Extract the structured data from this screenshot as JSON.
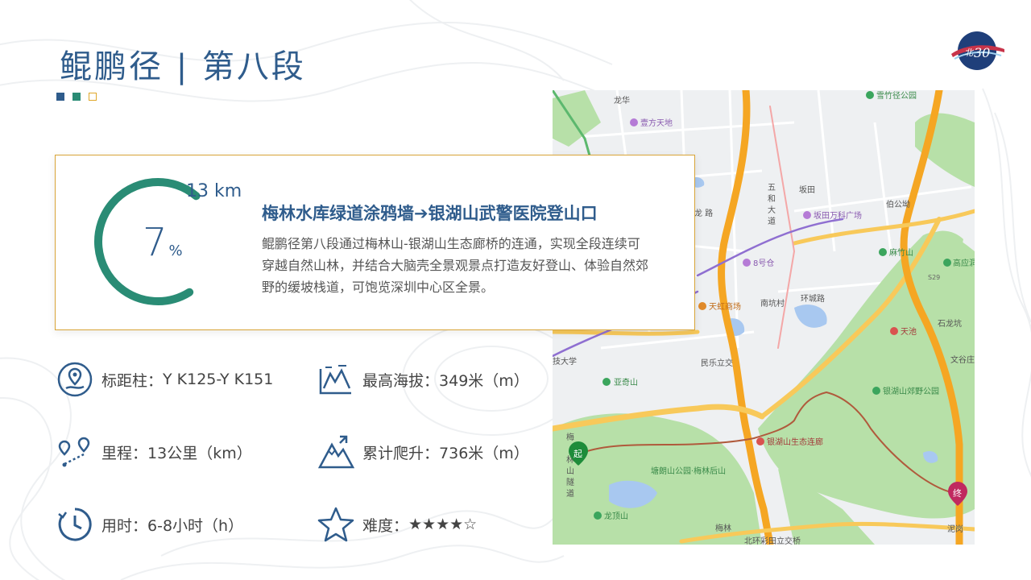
{
  "header": {
    "title": "鲲鹏径 | 第八段"
  },
  "summary": {
    "distance": "13 km",
    "percent": "7",
    "percent_unit": "%",
    "progress_fraction": 0.7,
    "route_title": "梅林水库绿道涂鸦墙➔银湖山武警医院登山口",
    "description": "鲲鹏径第八段通过梅林山-银湖山生态廊桥的连通，实现全段连续可穿越自然山林，并结合大脑壳全景观景点打造友好登山、体验自然郊野的缓坡栈道，可饱览深圳中心区全景。"
  },
  "stats": {
    "marker_label": "标距柱：",
    "marker_value": "Y K125-Y K151",
    "altitude_label": "最高海拔：",
    "altitude_value": "349米（m）",
    "distance_label": "里程：",
    "distance_value": "13公里（km）",
    "climb_label": "累计爬升：",
    "climb_value": "736米（m）",
    "time_label": "用时：",
    "time_value": "6-8小时（h）",
    "difficulty_label": "难度：",
    "difficulty_value": "★★★★☆"
  },
  "map": {
    "labels": {
      "longhua": "龙华",
      "yifang": "壹方天地",
      "xuezhuyuan": "雪竹径公园",
      "bantian": "坂田",
      "bantian_wanke": "坂田万科广场",
      "wuhe_1": "五",
      "wuhe_2": "和",
      "wuhe_3": "大",
      "wuhe_4": "道",
      "bogongao": "伯公坳",
      "longlu": "龙 路",
      "bahao": "8号仓",
      "mazhushan": "麻竹山",
      "gaoyingshan": "高应洞",
      "s29": "S29",
      "tianhong": "天虹商场",
      "nankengcun": "南坑村",
      "huanchenglu": "环城路",
      "shilongkeng": "石龙坑",
      "tianchi": "天池",
      "daxue": "技大学",
      "minle": "民乐立交",
      "wenguzhuang": "文谷庄",
      "yaqishan": "亚奇山",
      "yinhu_park": "银湖山郊野公园",
      "yinhu_bridge": "银湖山生态连廊",
      "tanglang": "塘朗山公园·梅林后山",
      "lingshan": "龙顶山",
      "meilin": "梅林",
      "beihuan": "北环彩田立交桥",
      "niganglu": "泥岗",
      "start": "起",
      "end": "终",
      "tunnel_1": "梅",
      "tunnel_2": "林",
      "tunnel_3": "山",
      "tunnel_4": "隧",
      "tunnel_5": "道"
    }
  },
  "colors": {
    "primary": "#2f5c8c",
    "accent_green": "#2a8c75",
    "card_border": "#d8a437"
  }
}
